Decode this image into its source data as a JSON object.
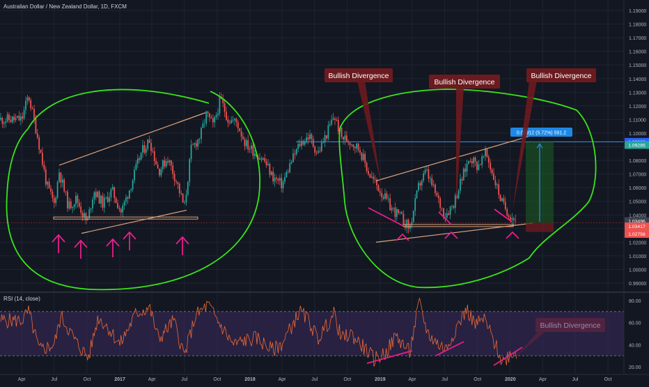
{
  "header": {
    "symbol_title": "Australian Dollar / New Zealand Dollar, 1D, FXCM"
  },
  "rsi_panel": {
    "title": "RSI (14, close)"
  },
  "colors": {
    "background": "#131722",
    "grid": "#1e2433",
    "up_candle": "#26a69a",
    "down_candle": "#ef5350",
    "annotation_green": "#39e619",
    "annotation_magenta": "#e91e8c",
    "trendline": "#e0a57c",
    "callout_bg": "#6b1b1f",
    "rsi_line": "#f06a35",
    "rsi_band": "#3a2a5c",
    "price_level_blue": "#2962ff",
    "measure_blue": "#1e88e5"
  },
  "annotations": {
    "callouts": [
      "Bullish Divergence",
      "Bullish Divergence",
      "Bullish Divergence",
      "Bullish Divergence"
    ],
    "measure_label": "0.05912 (5.72%) 591.2"
  },
  "chart_data": [
    {
      "type": "candlestick",
      "title": "Australian Dollar / New Zealand Dollar, 1D, FXCM",
      "x_tick_labels": [
        "Apr",
        "Jul",
        "Oct",
        "2017",
        "Apr",
        "Jul",
        "Oct",
        "2018",
        "Apr",
        "Jul",
        "Oct",
        "2019",
        "Apr",
        "Jul",
        "Oct",
        "2020",
        "Apr",
        "Jul",
        "Oct"
      ],
      "y_tick_labels": [
        "1.19000",
        "1.18000",
        "1.17000",
        "1.16000",
        "1.15000",
        "1.14000",
        "1.13000",
        "1.12000",
        "1.11000",
        "1.10000",
        "1.09000",
        "1.08000",
        "1.07000",
        "1.06000",
        "1.05000",
        "1.04000",
        "1.03000",
        "1.02000",
        "1.01000",
        "1.00000",
        "0.99000"
      ],
      "ylim": [
        0.985,
        1.195
      ],
      "price_labels": [
        {
          "text": "1.09366",
          "color": "#2962ff"
        },
        {
          "text": "1.09285",
          "color": "#26a69a"
        },
        {
          "text": "1.03496",
          "color": "#3d4252"
        },
        {
          "text": "1.03417",
          "color": "#ef5350"
        },
        {
          "text": "1.02756",
          "color": "#ef5350"
        }
      ],
      "close_path": [
        [
          "2016-04-01",
          1.11
        ],
        [
          "2016-04-20",
          1.128
        ],
        [
          "2016-05-15",
          1.098
        ],
        [
          "2016-06-10",
          1.062
        ],
        [
          "2016-07-01",
          1.048
        ],
        [
          "2016-07-15",
          1.072
        ],
        [
          "2016-08-10",
          1.046
        ],
        [
          "2016-09-01",
          1.052
        ],
        [
          "2016-10-01",
          1.034
        ],
        [
          "2016-10-20",
          1.058
        ],
        [
          "2016-11-15",
          1.048
        ],
        [
          "2016-12-10",
          1.058
        ],
        [
          "2017-01-05",
          1.042
        ],
        [
          "2017-02-01",
          1.062
        ],
        [
          "2017-03-01",
          1.085
        ],
        [
          "2017-03-25",
          1.095
        ],
        [
          "2017-04-20",
          1.072
        ],
        [
          "2017-05-15",
          1.082
        ],
        [
          "2017-06-10",
          1.064
        ],
        [
          "2017-07-01",
          1.045
        ],
        [
          "2017-07-20",
          1.088
        ],
        [
          "2017-08-15",
          1.098
        ],
        [
          "2017-09-01",
          1.114
        ],
        [
          "2017-09-20",
          1.105
        ],
        [
          "2017-10-10",
          1.125
        ],
        [
          "2017-11-01",
          1.11
        ],
        [
          "2017-11-25",
          1.108
        ],
        [
          "2017-12-20",
          1.092
        ],
        [
          "2018-01-15",
          1.086
        ],
        [
          "2018-02-10",
          1.08
        ],
        [
          "2018-03-05",
          1.068
        ],
        [
          "2018-04-01",
          1.062
        ],
        [
          "2018-04-25",
          1.078
        ],
        [
          "2018-05-20",
          1.092
        ],
        [
          "2018-06-15",
          1.098
        ],
        [
          "2018-07-10",
          1.085
        ],
        [
          "2018-08-05",
          1.1
        ],
        [
          "2018-08-25",
          1.113
        ],
        [
          "2018-09-15",
          1.097
        ],
        [
          "2018-10-10",
          1.094
        ],
        [
          "2018-11-05",
          1.088
        ],
        [
          "2018-12-01",
          1.07
        ],
        [
          "2019-01-01",
          1.058
        ],
        [
          "2019-02-01",
          1.045
        ],
        [
          "2019-03-01",
          1.038
        ],
        [
          "2019-03-25",
          1.03
        ],
        [
          "2019-04-20",
          1.062
        ],
        [
          "2019-05-10",
          1.072
        ],
        [
          "2019-06-01",
          1.058
        ],
        [
          "2019-07-01",
          1.04
        ],
        [
          "2019-07-25",
          1.048
        ],
        [
          "2019-08-20",
          1.068
        ],
        [
          "2019-09-10",
          1.083
        ],
        [
          "2019-10-01",
          1.076
        ],
        [
          "2019-10-25",
          1.085
        ],
        [
          "2019-11-15",
          1.068
        ],
        [
          "2019-12-10",
          1.048
        ],
        [
          "2020-01-01",
          1.04
        ],
        [
          "2020-01-20",
          1.035
        ]
      ]
    },
    {
      "type": "line",
      "title": "RSI (14, close)",
      "y_tick_labels": [
        "80.00",
        "60.00",
        "40.00",
        "20.00"
      ],
      "ylim": [
        15,
        85
      ],
      "bands": [
        70,
        30
      ],
      "values_path": [
        [
          "2016-04-01",
          62
        ],
        [
          "2016-04-20",
          70
        ],
        [
          "2016-05-20",
          35
        ],
        [
          "2016-07-01",
          40
        ],
        [
          "2016-07-20",
          66
        ],
        [
          "2016-09-01",
          42
        ],
        [
          "2016-10-05",
          28
        ],
        [
          "2016-11-01",
          65
        ],
        [
          "2016-12-01",
          55
        ],
        [
          "2017-01-01",
          40
        ],
        [
          "2017-02-15",
          68
        ],
        [
          "2017-03-25",
          74
        ],
        [
          "2017-04-20",
          45
        ],
        [
          "2017-06-01",
          62
        ],
        [
          "2017-07-01",
          30
        ],
        [
          "2017-08-01",
          66
        ],
        [
          "2017-09-05",
          76
        ],
        [
          "2017-10-10",
          58
        ],
        [
          "2017-11-15",
          40
        ],
        [
          "2017-12-20",
          44
        ],
        [
          "2018-01-20",
          46
        ],
        [
          "2018-03-05",
          35
        ],
        [
          "2018-04-01",
          41
        ],
        [
          "2018-05-20",
          70
        ],
        [
          "2018-06-15",
          62
        ],
        [
          "2018-07-10",
          45
        ],
        [
          "2018-08-25",
          68
        ],
        [
          "2018-09-15",
          45
        ],
        [
          "2018-10-10",
          50
        ],
        [
          "2018-11-15",
          38
        ],
        [
          "2018-12-15",
          27
        ],
        [
          "2019-01-15",
          32
        ],
        [
          "2019-02-15",
          48
        ],
        [
          "2019-03-25",
          33
        ],
        [
          "2019-04-20",
          78
        ],
        [
          "2019-05-15",
          50
        ],
        [
          "2019-06-15",
          40
        ],
        [
          "2019-07-05",
          36
        ],
        [
          "2019-08-01",
          55
        ],
        [
          "2019-09-01",
          72
        ],
        [
          "2019-09-25",
          58
        ],
        [
          "2019-10-20",
          63
        ],
        [
          "2019-11-20",
          40
        ],
        [
          "2019-12-10",
          24
        ],
        [
          "2020-01-01",
          32
        ],
        [
          "2020-01-20",
          34
        ]
      ]
    }
  ]
}
